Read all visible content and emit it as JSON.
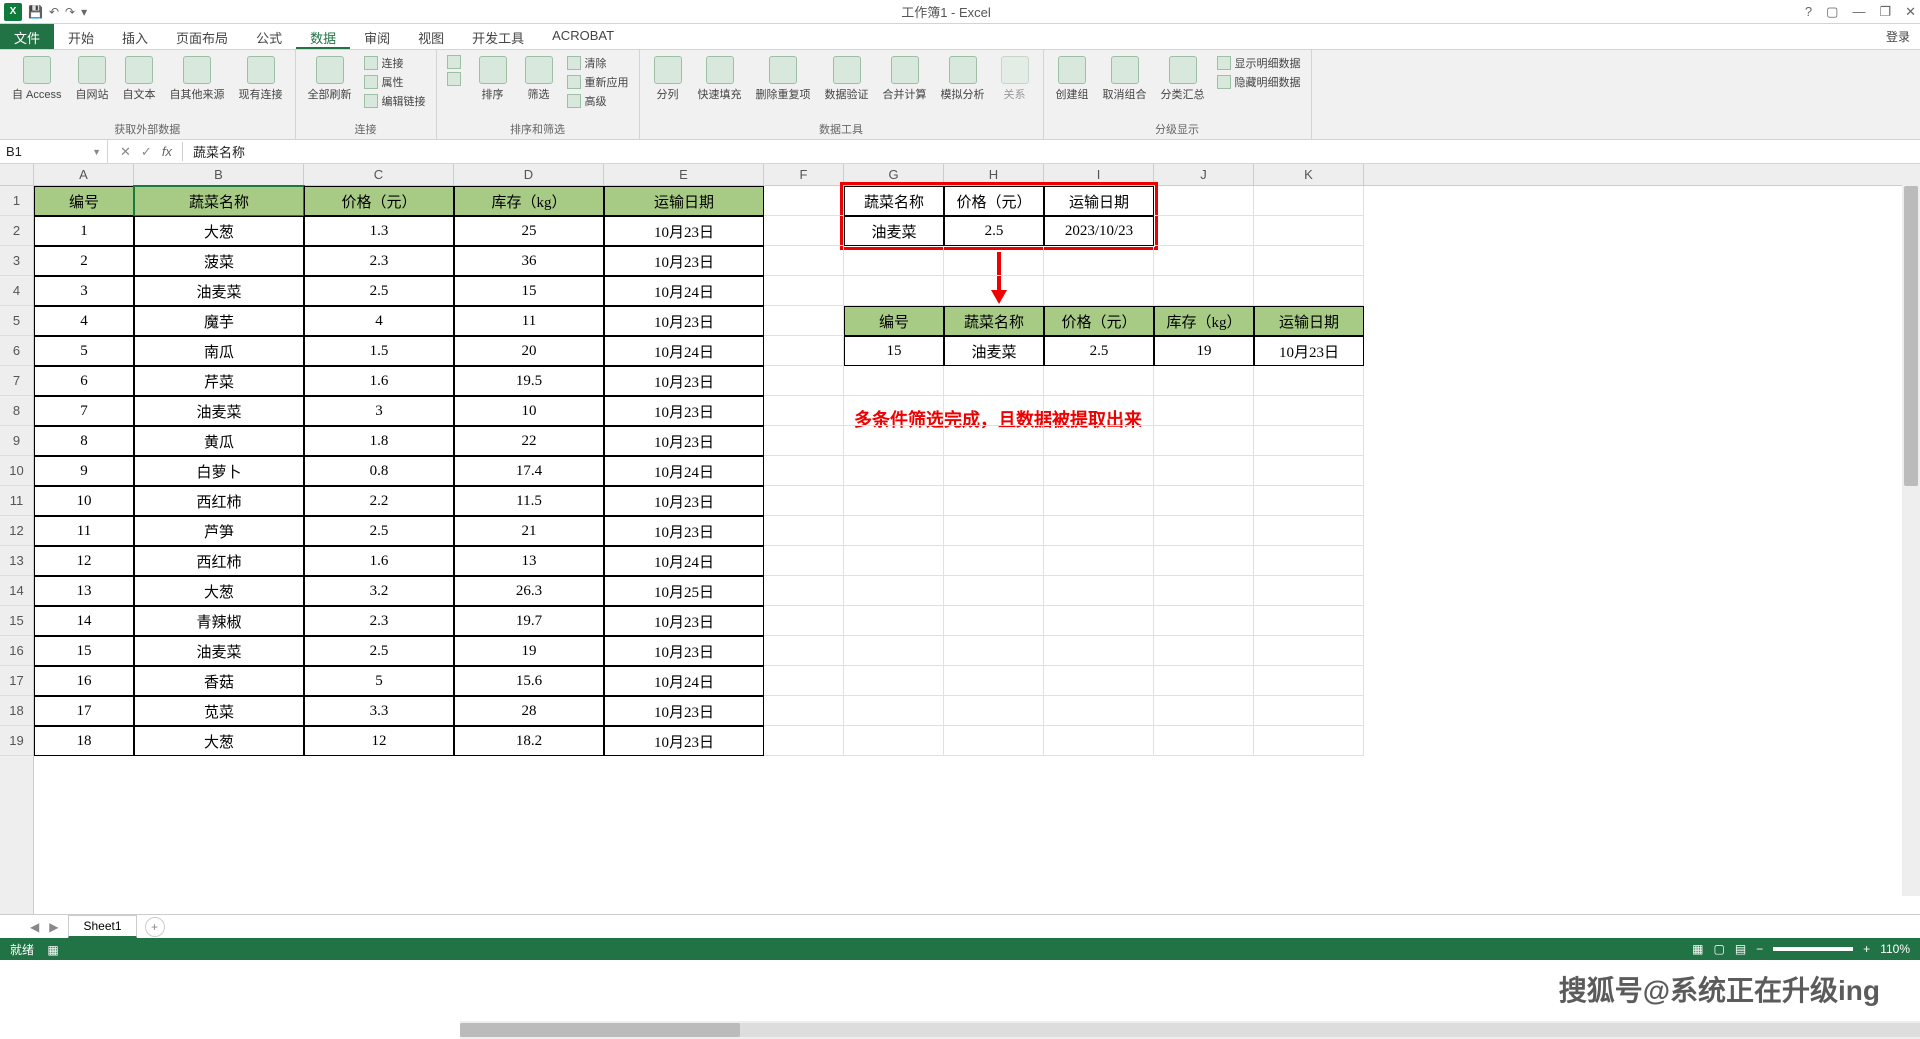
{
  "title": "工作簿1 - Excel",
  "login": "登录",
  "tabs": {
    "file": "文件",
    "items": [
      "开始",
      "插入",
      "页面布局",
      "公式",
      "数据",
      "审阅",
      "视图",
      "开发工具",
      "ACROBAT"
    ],
    "active": "数据"
  },
  "ribbon": {
    "g1": {
      "label": "获取外部数据",
      "btns": [
        "自 Access",
        "自网站",
        "自文本",
        "自其他来源",
        "现有连接"
      ]
    },
    "g2": {
      "label": "连接",
      "refresh": "全部刷新",
      "items": [
        "连接",
        "属性",
        "编辑链接"
      ]
    },
    "g3": {
      "label": "排序和筛选",
      "sort": "排序",
      "filter": "筛选",
      "items": [
        "清除",
        "重新应用",
        "高级"
      ]
    },
    "g4": {
      "label": "数据工具",
      "btns": [
        "分列",
        "快速填充",
        "删除重复项",
        "数据验证",
        "合并计算",
        "模拟分析",
        "关系"
      ]
    },
    "g5": {
      "label": "分级显示",
      "btns": [
        "创建组",
        "取消组合",
        "分类汇总"
      ],
      "items": [
        "显示明细数据",
        "隐藏明细数据"
      ]
    }
  },
  "namebox": "B1",
  "formula": "蔬菜名称",
  "cols": [
    "A",
    "B",
    "C",
    "D",
    "E",
    "F",
    "G",
    "H",
    "I",
    "J",
    "K"
  ],
  "rows": [
    "1",
    "2",
    "3",
    "4",
    "5",
    "6",
    "7",
    "8",
    "9",
    "10",
    "11",
    "12",
    "13",
    "14",
    "15",
    "16",
    "17",
    "18",
    "19"
  ],
  "headers": [
    "编号",
    "蔬菜名称",
    "价格（元）",
    "库存（kg）",
    "运输日期"
  ],
  "data_rows": [
    [
      "1",
      "大葱",
      "1.3",
      "25",
      "10月23日"
    ],
    [
      "2",
      "菠菜",
      "2.3",
      "36",
      "10月23日"
    ],
    [
      "3",
      "油麦菜",
      "2.5",
      "15",
      "10月24日"
    ],
    [
      "4",
      "魔芋",
      "4",
      "11",
      "10月23日"
    ],
    [
      "5",
      "南瓜",
      "1.5",
      "20",
      "10月24日"
    ],
    [
      "6",
      "芹菜",
      "1.6",
      "19.5",
      "10月23日"
    ],
    [
      "7",
      "油麦菜",
      "3",
      "10",
      "10月23日"
    ],
    [
      "8",
      "黄瓜",
      "1.8",
      "22",
      "10月23日"
    ],
    [
      "9",
      "白萝卜",
      "0.8",
      "17.4",
      "10月24日"
    ],
    [
      "10",
      "西红柿",
      "2.2",
      "11.5",
      "10月23日"
    ],
    [
      "11",
      "芦笋",
      "2.5",
      "21",
      "10月23日"
    ],
    [
      "12",
      "西红柿",
      "1.6",
      "13",
      "10月24日"
    ],
    [
      "13",
      "大葱",
      "3.2",
      "26.3",
      "10月25日"
    ],
    [
      "14",
      "青辣椒",
      "2.3",
      "19.7",
      "10月23日"
    ],
    [
      "15",
      "油麦菜",
      "2.5",
      "19",
      "10月23日"
    ],
    [
      "16",
      "香菇",
      "5",
      "15.6",
      "10月24日"
    ],
    [
      "17",
      "苋菜",
      "3.3",
      "28",
      "10月23日"
    ],
    [
      "18",
      "大葱",
      "12",
      "18.2",
      "10月23日"
    ]
  ],
  "criteria": {
    "h": [
      "蔬菜名称",
      "价格（元）",
      "运输日期"
    ],
    "v": [
      "油麦菜",
      "2.5",
      "2023/10/23"
    ]
  },
  "result": {
    "h": [
      "编号",
      "蔬菜名称",
      "价格（元）",
      "库存（kg）",
      "运输日期"
    ],
    "v": [
      "15",
      "油麦菜",
      "2.5",
      "19",
      "10月23日"
    ]
  },
  "annot": "多条件筛选完成，且数据被提取出来",
  "sheet": "Sheet1",
  "status": "就绪",
  "zoom": "110%",
  "watermark": "搜狐号@系统正在升级ing"
}
